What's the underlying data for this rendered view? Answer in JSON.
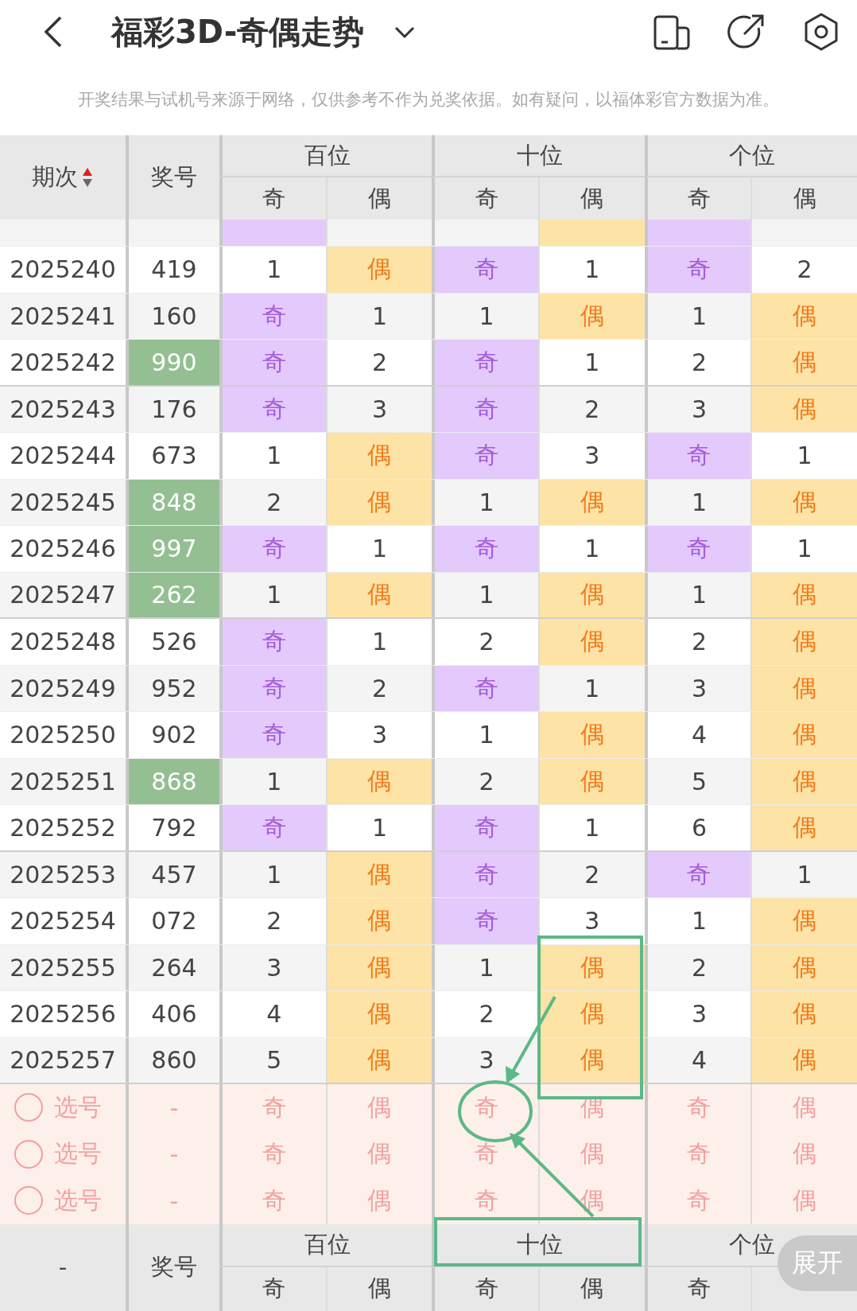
{
  "header": {
    "title": "福彩3D-奇偶走势"
  },
  "notice": "开奖结果与试机号来源于网络，仅供参考不作为兑奖依据。如有疑问，以福体彩官方数据为准。",
  "table": {
    "period_label": "期次",
    "sort_ascending": true,
    "number_label": "奖号",
    "groups": [
      {
        "label": "百位",
        "subcolumns": [
          "奇",
          "偶"
        ]
      },
      {
        "label": "十位",
        "subcolumns": [
          "奇",
          "偶"
        ]
      },
      {
        "label": "个位",
        "subcolumns": [
          "奇",
          "偶"
        ]
      }
    ],
    "rows": [
      {
        "highlighted": false,
        "cells": [
          {
            "hit": true
          },
          {
            "hit": false
          },
          {
            "hit": false
          },
          {
            "hit": true
          },
          {
            "hit": true
          },
          {
            "hit": false
          }
        ]
      },
      {
        "period": "2025240",
        "number": "419",
        "highlighted": false,
        "cells": [
          {
            "text": "1",
            "hit": false
          },
          {
            "text": "偶",
            "hit": true
          },
          {
            "text": "奇",
            "hit": true
          },
          {
            "text": "1",
            "hit": false
          },
          {
            "text": "奇",
            "hit": true
          },
          {
            "text": "2",
            "hit": false
          }
        ]
      },
      {
        "period": "2025241",
        "number": "160",
        "highlighted": false,
        "cells": [
          {
            "text": "奇",
            "hit": true
          },
          {
            "text": "1",
            "hit": false
          },
          {
            "text": "1",
            "hit": false
          },
          {
            "text": "偶",
            "hit": true
          },
          {
            "text": "1",
            "hit": false
          },
          {
            "text": "偶",
            "hit": true
          }
        ]
      },
      {
        "period": "2025242",
        "number": "990",
        "highlighted": true,
        "cells": [
          {
            "text": "奇",
            "hit": true
          },
          {
            "text": "2",
            "hit": false
          },
          {
            "text": "奇",
            "hit": true
          },
          {
            "text": "1",
            "hit": false
          },
          {
            "text": "2",
            "hit": false
          },
          {
            "text": "偶",
            "hit": true
          }
        ]
      },
      {
        "period": "2025243",
        "number": "176",
        "highlighted": false,
        "cells": [
          {
            "text": "奇",
            "hit": true
          },
          {
            "text": "3",
            "hit": false
          },
          {
            "text": "奇",
            "hit": true
          },
          {
            "text": "2",
            "hit": false
          },
          {
            "text": "3",
            "hit": false
          },
          {
            "text": "偶",
            "hit": true
          }
        ]
      },
      {
        "period": "2025244",
        "number": "673",
        "highlighted": false,
        "cells": [
          {
            "text": "1",
            "hit": false
          },
          {
            "text": "偶",
            "hit": true
          },
          {
            "text": "奇",
            "hit": true
          },
          {
            "text": "3",
            "hit": false
          },
          {
            "text": "奇",
            "hit": true
          },
          {
            "text": "1",
            "hit": false
          }
        ]
      },
      {
        "period": "2025245",
        "number": "848",
        "highlighted": true,
        "cells": [
          {
            "text": "2",
            "hit": false
          },
          {
            "text": "偶",
            "hit": true
          },
          {
            "text": "1",
            "hit": false
          },
          {
            "text": "偶",
            "hit": true
          },
          {
            "text": "1",
            "hit": false
          },
          {
            "text": "偶",
            "hit": true
          }
        ]
      },
      {
        "period": "2025246",
        "number": "997",
        "highlighted": true,
        "cells": [
          {
            "text": "奇",
            "hit": true
          },
          {
            "text": "1",
            "hit": false
          },
          {
            "text": "奇",
            "hit": true
          },
          {
            "text": "1",
            "hit": false
          },
          {
            "text": "奇",
            "hit": true
          },
          {
            "text": "1",
            "hit": false
          }
        ]
      },
      {
        "period": "2025247",
        "number": "262",
        "highlighted": true,
        "cells": [
          {
            "text": "1",
            "hit": false
          },
          {
            "text": "偶",
            "hit": true
          },
          {
            "text": "1",
            "hit": false
          },
          {
            "text": "偶",
            "hit": true
          },
          {
            "text": "1",
            "hit": false
          },
          {
            "text": "偶",
            "hit": true
          }
        ]
      },
      {
        "period": "2025248",
        "number": "526",
        "highlighted": false,
        "cells": [
          {
            "text": "奇",
            "hit": true
          },
          {
            "text": "1",
            "hit": false
          },
          {
            "text": "2",
            "hit": false
          },
          {
            "text": "偶",
            "hit": true
          },
          {
            "text": "2",
            "hit": false
          },
          {
            "text": "偶",
            "hit": true
          }
        ]
      },
      {
        "period": "2025249",
        "number": "952",
        "highlighted": false,
        "cells": [
          {
            "text": "奇",
            "hit": true
          },
          {
            "text": "2",
            "hit": false
          },
          {
            "text": "奇",
            "hit": true
          },
          {
            "text": "1",
            "hit": false
          },
          {
            "text": "3",
            "hit": false
          },
          {
            "text": "偶",
            "hit": true
          }
        ]
      },
      {
        "period": "2025250",
        "number": "902",
        "highlighted": false,
        "cells": [
          {
            "text": "奇",
            "hit": true
          },
          {
            "text": "3",
            "hit": false
          },
          {
            "text": "1",
            "hit": false
          },
          {
            "text": "偶",
            "hit": true
          },
          {
            "text": "4",
            "hit": false
          },
          {
            "text": "偶",
            "hit": true
          }
        ]
      },
      {
        "period": "2025251",
        "number": "868",
        "highlighted": true,
        "cells": [
          {
            "text": "1",
            "hit": false
          },
          {
            "text": "偶",
            "hit": true
          },
          {
            "text": "2",
            "hit": false
          },
          {
            "text": "偶",
            "hit": true
          },
          {
            "text": "5",
            "hit": false
          },
          {
            "text": "偶",
            "hit": true
          }
        ]
      },
      {
        "period": "2025252",
        "number": "792",
        "highlighted": false,
        "cells": [
          {
            "text": "奇",
            "hit": true
          },
          {
            "text": "1",
            "hit": false
          },
          {
            "text": "奇",
            "hit": true
          },
          {
            "text": "1",
            "hit": false
          },
          {
            "text": "6",
            "hit": false
          },
          {
            "text": "偶",
            "hit": true
          }
        ]
      },
      {
        "period": "2025253",
        "number": "457",
        "highlighted": false,
        "cells": [
          {
            "text": "1",
            "hit": false
          },
          {
            "text": "偶",
            "hit": true
          },
          {
            "text": "奇",
            "hit": true
          },
          {
            "text": "2",
            "hit": false
          },
          {
            "text": "奇",
            "hit": true
          },
          {
            "text": "1",
            "hit": false
          }
        ]
      },
      {
        "period": "2025254",
        "number": "072",
        "highlighted": false,
        "cells": [
          {
            "text": "2",
            "hit": false
          },
          {
            "text": "偶",
            "hit": true
          },
          {
            "text": "奇",
            "hit": true
          },
          {
            "text": "3",
            "hit": false
          },
          {
            "text": "1",
            "hit": false
          },
          {
            "text": "偶",
            "hit": true
          }
        ]
      },
      {
        "period": "2025255",
        "number": "264",
        "highlighted": false,
        "cells": [
          {
            "text": "3",
            "hit": false
          },
          {
            "text": "偶",
            "hit": true
          },
          {
            "text": "1",
            "hit": false
          },
          {
            "text": "偶",
            "hit": true
          },
          {
            "text": "2",
            "hit": false
          },
          {
            "text": "偶",
            "hit": true
          }
        ]
      },
      {
        "period": "2025256",
        "number": "406",
        "highlighted": false,
        "cells": [
          {
            "text": "4",
            "hit": false
          },
          {
            "text": "偶",
            "hit": true
          },
          {
            "text": "2",
            "hit": false
          },
          {
            "text": "偶",
            "hit": true
          },
          {
            "text": "3",
            "hit": false
          },
          {
            "text": "偶",
            "hit": true
          }
        ]
      },
      {
        "period": "2025257",
        "number": "860",
        "highlighted": false,
        "cells": [
          {
            "text": "5",
            "hit": false
          },
          {
            "text": "偶",
            "hit": true
          },
          {
            "text": "3",
            "hit": false
          },
          {
            "text": "偶",
            "hit": true
          },
          {
            "text": "4",
            "hit": false
          },
          {
            "text": "偶",
            "hit": true
          }
        ]
      }
    ],
    "pick_rows": [
      {
        "label": "选号",
        "number": "-",
        "selected": false,
        "options": [
          "奇",
          "偶",
          "奇",
          "偶",
          "奇",
          "偶"
        ]
      },
      {
        "label": "选号",
        "number": "-",
        "selected": false,
        "options": [
          "奇",
          "偶",
          "奇",
          "偶",
          "奇",
          "偶"
        ]
      },
      {
        "label": "选号",
        "number": "-",
        "selected": false,
        "options": [
          "奇",
          "偶",
          "奇",
          "偶",
          "奇",
          "偶"
        ]
      }
    ],
    "footer": {
      "period": "-",
      "number_label": "奖号",
      "groups": [
        {
          "label": "百位",
          "subcolumns": [
            "奇",
            "偶"
          ]
        },
        {
          "label": "十位",
          "subcolumns": [
            "奇",
            "偶"
          ]
        },
        {
          "label": "个位",
          "subcolumns": [
            "奇"
          ]
        }
      ]
    }
  },
  "expand_button": "展开"
}
